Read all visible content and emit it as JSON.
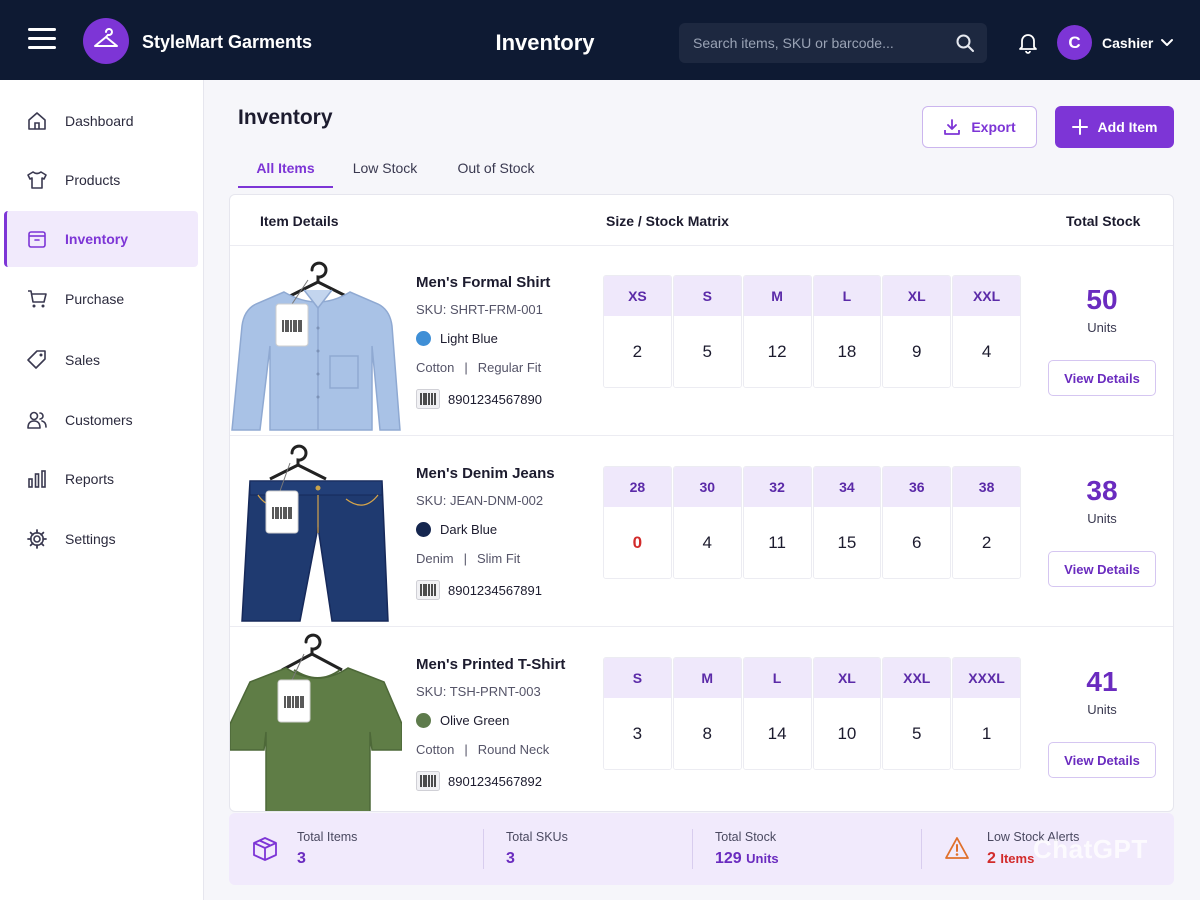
{
  "header": {
    "brand": "StyleMart Garments",
    "title": "Inventory",
    "search_placeholder": "Search items, SKU or barcode...",
    "avatar_initial": "C",
    "user_name": "Cashier"
  },
  "sidebar": {
    "items": [
      {
        "label": "Dashboard",
        "icon": "home-icon"
      },
      {
        "label": "Products",
        "icon": "tshirt-icon"
      },
      {
        "label": "Inventory",
        "icon": "box-icon",
        "active": true
      },
      {
        "label": "Purchase",
        "icon": "cart-icon"
      },
      {
        "label": "Sales",
        "icon": "tag-icon"
      },
      {
        "label": "Customers",
        "icon": "users-icon"
      },
      {
        "label": "Reports",
        "icon": "bar-chart-icon"
      },
      {
        "label": "Settings",
        "icon": "gear-icon"
      }
    ]
  },
  "main": {
    "title": "Inventory",
    "export_label": "Export",
    "add_label": "Add Item",
    "tabs": [
      {
        "label": "All Items",
        "active": true
      },
      {
        "label": "Low Stock"
      },
      {
        "label": "Out of Stock"
      }
    ],
    "columns": {
      "details": "Item Details",
      "matrix": "Size / Stock Matrix",
      "total": "Total Stock"
    },
    "items": [
      {
        "name": "Men's Formal Shirt",
        "sku": "SKU: SHRT-FRM-001",
        "color_name": "Light Blue",
        "color_hex": "#3f8fd6",
        "material": "Cotton",
        "fit": "Regular Fit",
        "barcode": "8901234567890",
        "sizes": [
          "XS",
          "S",
          "M",
          "L",
          "XL",
          "XXL"
        ],
        "quantities": [
          "2",
          "5",
          "12",
          "18",
          "9",
          "4"
        ],
        "total": "50",
        "unit_label": "Units",
        "view_label": "View Details"
      },
      {
        "name": "Men's Denim Jeans",
        "sku": "SKU: JEAN-DNM-002",
        "color_name": "Dark Blue",
        "color_hex": "#15264f",
        "material": "Denim",
        "fit": "Slim Fit",
        "barcode": "8901234567891",
        "sizes": [
          "28",
          "30",
          "32",
          "34",
          "36",
          "38"
        ],
        "quantities": [
          "0",
          "4",
          "11",
          "15",
          "6",
          "2"
        ],
        "total": "38",
        "unit_label": "Units",
        "view_label": "View Details"
      },
      {
        "name": "Men's Printed T-Shirt",
        "sku": "SKU: TSH-PRNT-003",
        "color_name": "Olive Green",
        "color_hex": "#5e7b4c",
        "material": "Cotton",
        "fit": "Round Neck",
        "barcode": "8901234567892",
        "sizes": [
          "S",
          "M",
          "L",
          "XL",
          "XXL",
          "XXXL"
        ],
        "quantities": [
          "3",
          "8",
          "14",
          "10",
          "5",
          "1"
        ],
        "total": "41",
        "unit_label": "Units",
        "view_label": "View Details"
      }
    ]
  },
  "summary": {
    "total_items_label": "Total Items",
    "total_items_value": "3",
    "total_skus_label": "Total SKUs",
    "total_skus_value": "3",
    "total_stock_label": "Total Stock",
    "total_stock_value": "129",
    "total_stock_unit": "Units",
    "alerts_label": "Low Stock Alerts",
    "alerts_value": "2",
    "alerts_unit": "Items"
  },
  "watermark": "ChatGPT",
  "colors": {
    "accent": "#7d35d6",
    "topbar": "#0e1a33",
    "alert": "#d22b2b"
  }
}
